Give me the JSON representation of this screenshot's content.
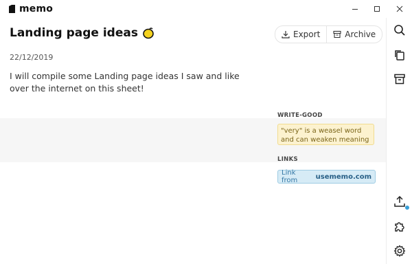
{
  "app": {
    "name": "memo"
  },
  "window": {
    "minimize": "minimize-icon",
    "maximize": "maximize-icon",
    "close": "close-icon"
  },
  "note": {
    "title": "Landing page ideas",
    "title_emoji": "lemon",
    "date": "22/12/2019",
    "body": "I will compile some Landing page ideas I saw and like over the internet on this sheet!"
  },
  "toolbar": {
    "export_label": "Export",
    "archive_label": "Archive"
  },
  "panel": {
    "write_good_heading": "WRITE-GOOD",
    "write_good_message": "\"very\" is a weasel word and can weaken meaning",
    "links_heading": "LINKS",
    "link_prefix": "Link from",
    "link_domain": "usememo.com"
  },
  "rail_icons": [
    "search-icon",
    "copy-icon",
    "archive-icon",
    "upload-icon",
    "puzzle-icon",
    "gear-icon"
  ],
  "colors": {
    "accent": "#3aa0d8",
    "warning_bg": "#fcf2cf",
    "link_bg": "#d6ebf6"
  }
}
